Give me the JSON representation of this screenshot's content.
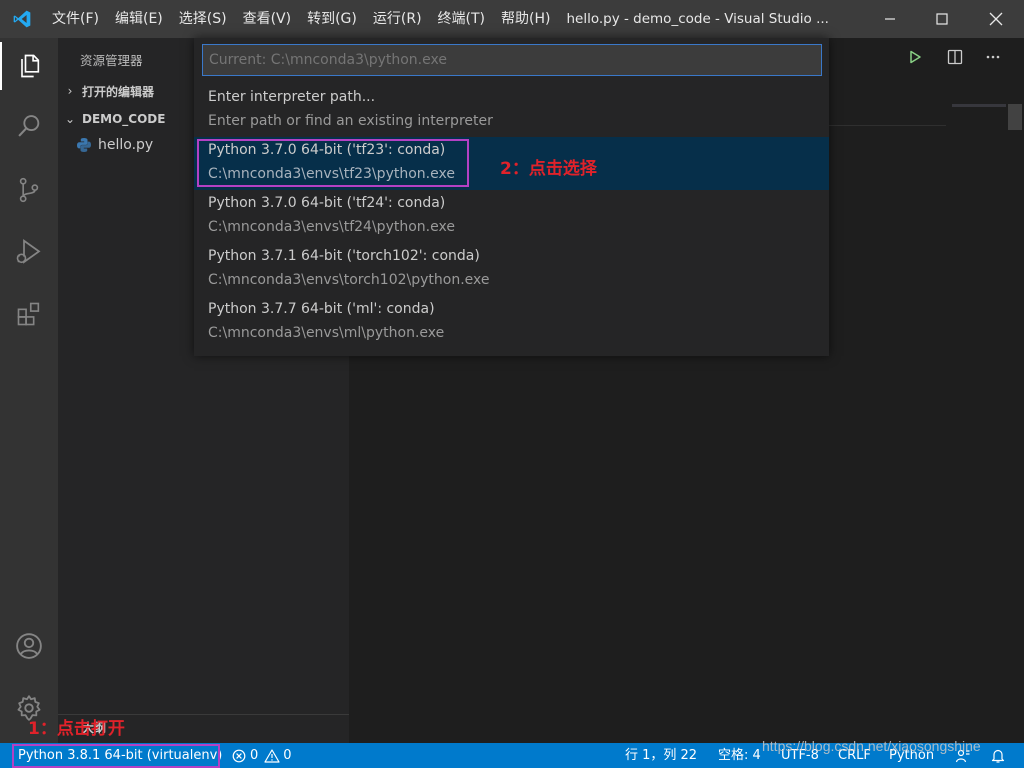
{
  "titlebar": {
    "menu": [
      "文件(F)",
      "编辑(E)",
      "选择(S)",
      "查看(V)",
      "转到(G)",
      "运行(R)",
      "终端(T)",
      "帮助(H)"
    ],
    "window_title": "hello.py - demo_code - Visual Studio ..."
  },
  "activity_bar": {
    "icons": [
      "explorer-icon",
      "search-icon",
      "source-control-icon",
      "run-debug-icon",
      "extensions-icon",
      "accounts-icon",
      "manage-gear-icon"
    ]
  },
  "sidebar": {
    "title": "资源管理器",
    "open_editors": "打开的编辑器",
    "folder": "DEMO_CODE",
    "files": [
      "hello.py"
    ],
    "outline": "大纲"
  },
  "quick_pick": {
    "input_placeholder": "Current: C:\\mnconda3\\python.exe",
    "items": [
      {
        "label": "Enter interpreter path...",
        "detail": "Enter path or find an existing interpreter"
      },
      {
        "label": "Python 3.7.0 64-bit ('tf23': conda)",
        "detail": "C:\\mnconda3\\envs\\tf23\\python.exe"
      },
      {
        "label": "Python 3.7.0 64-bit ('tf24': conda)",
        "detail": "C:\\mnconda3\\envs\\tf24\\python.exe"
      },
      {
        "label": "Python 3.7.1 64-bit ('torch102': conda)",
        "detail": "C:\\mnconda3\\envs\\torch102\\python.exe"
      },
      {
        "label": "Python 3.7.7 64-bit ('ml': conda)",
        "detail": "C:\\mnconda3\\envs\\ml\\python.exe"
      }
    ],
    "selected_index": 1
  },
  "annotations": {
    "step1": "1：点击打开",
    "step2": "2：点击选择",
    "color": "#e0222a",
    "box_color": "#b341c4"
  },
  "statusbar": {
    "interpreter": "Python 3.8.1 64-bit (virtualenv)",
    "errors": "0",
    "warnings": "0",
    "position": "行 1，列 22",
    "spaces": "空格: 4",
    "encoding": "UTF-8",
    "eol": "CRLF",
    "language": "Python",
    "color": "#007acc"
  },
  "watermark": "https://blog.csdn.net/xiaosongshine"
}
